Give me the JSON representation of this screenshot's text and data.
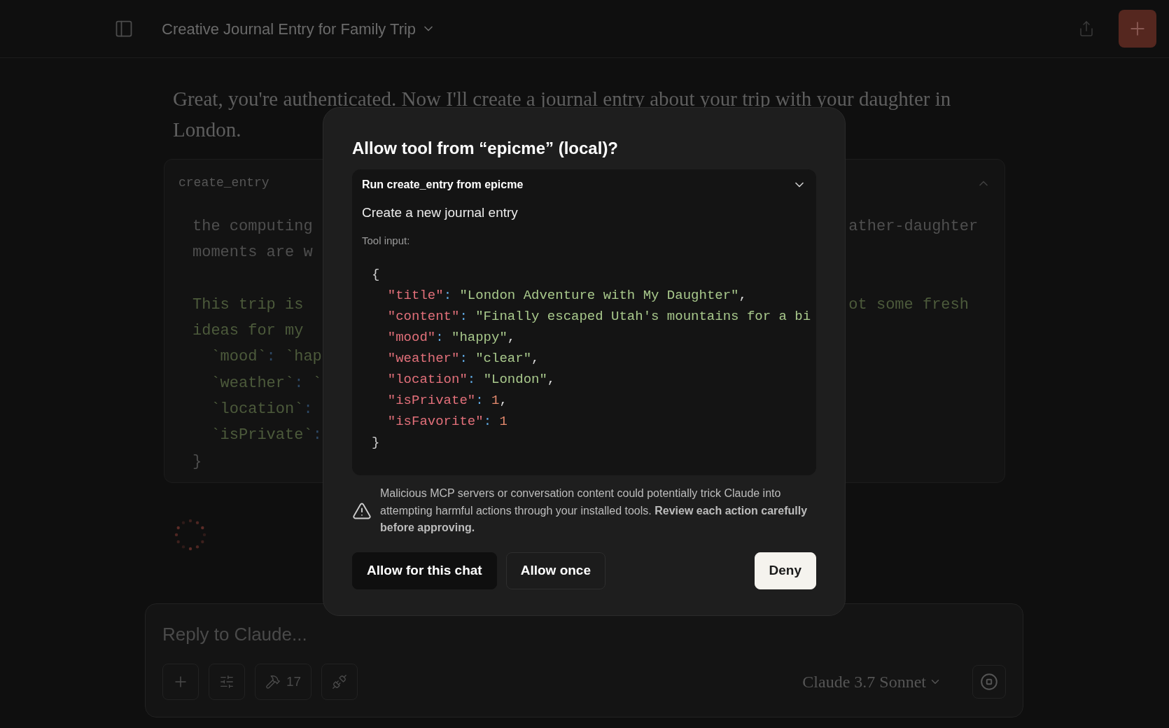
{
  "header": {
    "title": "Creative Journal Entry for Family Trip"
  },
  "message": {
    "text": "Great, you're authenticated. Now I'll create a journal entry about your trip with your daughter in London."
  },
  "tool_block": {
    "name": "create_entry",
    "expanded": true,
    "lines": [
      {
        "kind": "text",
        "left": [
          {
            "kind": "plain",
            "text": "the computing"
          }
        ],
        "right": {
          "kind": "plain",
          "text": "ather-daughter"
        }
      },
      {
        "kind": "text",
        "left": [
          {
            "kind": "plain",
            "text": "moments are w"
          }
        ]
      },
      {
        "kind": "blank"
      },
      {
        "kind": "text",
        "left": [
          {
            "kind": "note",
            "text": "This trip is"
          }
        ],
        "right": {
          "kind": "note",
          "text": "ot some fresh"
        }
      },
      {
        "kind": "text",
        "left": [
          {
            "kind": "note",
            "text": "ideas for my"
          }
        ]
      },
      {
        "kind": "field",
        "left": [
          {
            "kind": "note",
            "text": "`mood`"
          },
          {
            "kind": "colon",
            "text": ":"
          },
          {
            "kind": "note",
            "text": "`hap"
          }
        ]
      },
      {
        "kind": "field",
        "left": [
          {
            "kind": "note",
            "text": "`weather`"
          },
          {
            "kind": "colon",
            "text": ":"
          },
          {
            "kind": "note",
            "text": "`"
          }
        ]
      },
      {
        "kind": "field",
        "left": [
          {
            "kind": "note",
            "text": "`location`"
          },
          {
            "kind": "colon",
            "text": ":"
          }
        ]
      },
      {
        "kind": "field",
        "left": [
          {
            "kind": "note",
            "text": "`isPrivate`"
          },
          {
            "kind": "colon",
            "text": ":"
          }
        ]
      },
      {
        "kind": "text",
        "left": [
          {
            "kind": "plain",
            "text": "}"
          }
        ]
      }
    ]
  },
  "dialog": {
    "title": "Allow tool from “epicme” (local)?",
    "tool_run": "Run create_entry from epicme",
    "expanded": true,
    "description": "Create a new journal entry",
    "input_label": "Tool input:",
    "input": {
      "open": "{",
      "close": "}",
      "fields": [
        [
          {
            "kind": "key",
            "text": "\"title\""
          },
          {
            "kind": "colon",
            "text": ":"
          },
          {
            "kind": "str",
            "text": "\"London Adventure with My Daughter\""
          },
          {
            "kind": "punct",
            "text": ","
          }
        ],
        [
          {
            "kind": "key",
            "text": "\"content\""
          },
          {
            "kind": "colon",
            "text": ":"
          },
          {
            "kind": "str",
            "text": "\"Finally escaped Utah's mountains for a bi"
          }
        ],
        [
          {
            "kind": "key",
            "text": "\"mood\""
          },
          {
            "kind": "colon",
            "text": ":"
          },
          {
            "kind": "str",
            "text": "\"happy\""
          },
          {
            "kind": "punct",
            "text": ","
          }
        ],
        [
          {
            "kind": "key",
            "text": "\"weather\""
          },
          {
            "kind": "colon",
            "text": ":"
          },
          {
            "kind": "str",
            "text": "\"clear\""
          },
          {
            "kind": "punct",
            "text": ","
          }
        ],
        [
          {
            "kind": "key",
            "text": "\"location\""
          },
          {
            "kind": "colon",
            "text": ":"
          },
          {
            "kind": "str",
            "text": "\"London\""
          },
          {
            "kind": "punct",
            "text": ","
          }
        ],
        [
          {
            "kind": "key",
            "text": "\"isPrivate\""
          },
          {
            "kind": "colon",
            "text": ":"
          },
          {
            "kind": "num",
            "text": "1"
          },
          {
            "kind": "punct",
            "text": ","
          }
        ],
        [
          {
            "kind": "key",
            "text": "\"isFavorite\""
          },
          {
            "kind": "colon",
            "text": ":"
          },
          {
            "kind": "num",
            "text": "1"
          }
        ]
      ]
    },
    "warning": "Malicious MCP servers or conversation content could potentially trick Claude into attempting harmful actions through your installed tools. **Review each action carefully before approving.**",
    "buttons": [
      {
        "label": "Allow for this chat",
        "kind": "dark"
      },
      {
        "label": "Allow once",
        "kind": "outline"
      },
      {
        "label": "Deny",
        "kind": "light"
      }
    ]
  },
  "composer": {
    "placeholder": "Reply to Claude...",
    "tools_count": "17",
    "model": "Claude 3.7 Sonnet"
  }
}
